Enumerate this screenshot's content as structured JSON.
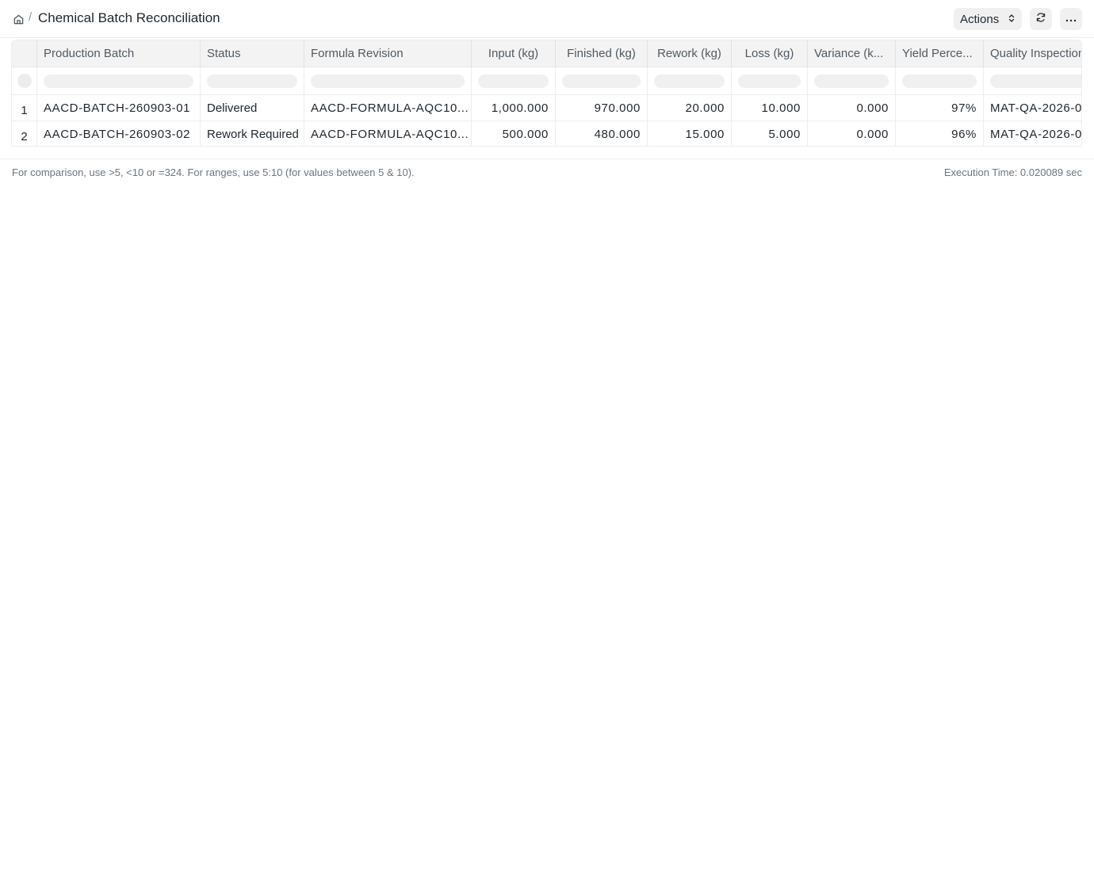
{
  "breadcrumb": {
    "separator": "/",
    "title": "Chemical Batch Reconciliation"
  },
  "toolbar": {
    "actions_label": "Actions",
    "refresh_icon": "refresh-icon",
    "more_icon": "more-icon"
  },
  "table": {
    "columns": [
      "Production Batch",
      "Status",
      "Formula Revision",
      "Input (kg)",
      "Finished (kg)",
      "Rework (kg)",
      "Loss (kg)",
      "Variance (k...",
      "Yield Perce...",
      "Quality Inspection"
    ],
    "rows": [
      {
        "num": "1",
        "batch": "AACD-BATCH-260903-01",
        "status": "Delivered",
        "formula": "AACD-FORMULA-AQC10...",
        "input": "1,000.000",
        "finished": "970.000",
        "rework": "20.000",
        "loss": "10.000",
        "variance": "0.000",
        "yield": "97%",
        "qi": "MAT-QA-2026-0"
      },
      {
        "num": "2",
        "batch": "AACD-BATCH-260903-02",
        "status": "Rework Required",
        "formula": "AACD-FORMULA-AQC10...",
        "input": "500.000",
        "finished": "480.000",
        "rework": "15.000",
        "loss": "5.000",
        "variance": "0.000",
        "yield": "96%",
        "qi": "MAT-QA-2026-0"
      }
    ]
  },
  "footer": {
    "hint": "For comparison, use >5, <10 or =324. For ranges, use 5:10 (for values between 5 & 10).",
    "execution_time": "Execution Time: 0.020089 sec"
  }
}
